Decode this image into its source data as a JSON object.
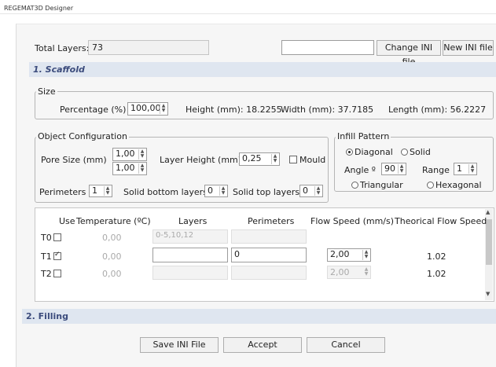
{
  "window": {
    "title": "REGEMAT3D Designer"
  },
  "top": {
    "total_layers_label": "Total Layers:",
    "total_layers_value": "73",
    "ini_path_value": "",
    "change_ini_label": "Change INI file",
    "new_ini_label": "New INI file"
  },
  "scaffold": {
    "section_title": "1. Scaffold",
    "size": {
      "group_label": "Size",
      "percentage_label": "Percentage (%)",
      "percentage_value": "100,00",
      "height_label": "Height (mm): 18.2255",
      "width_label": "Width (mm): 37.7185",
      "length_label": "Length (mm): 56.2227"
    },
    "object_config": {
      "group_label": "Object Configuration",
      "pore_size_label": "Pore Size (mm)",
      "pore_size_1": "1,00",
      "pore_size_2": "1,00",
      "layer_height_label": "Layer Height (mm)",
      "layer_height_value": "0,25",
      "mould_label": "Mould",
      "perimeters_label": "Perimeters",
      "perimeters_value": "1",
      "solid_bottom_label": "Solid bottom layers",
      "solid_bottom_value": "0",
      "solid_top_label": "Solid top layers",
      "solid_top_value": "0"
    },
    "infill": {
      "group_label": "Infill Pattern",
      "diagonal_label": "Diagonal",
      "solid_label": "Solid",
      "angle_label": "Angle º",
      "angle_value": "90",
      "range_label": "Range",
      "range_value": "1",
      "triangular_label": "Triangular",
      "hexagonal_label": "Hexagonal",
      "selected": "Diagonal"
    },
    "tools": {
      "headers": {
        "use": "Use",
        "temperature": "Temperature (ºC)",
        "layers": "Layers",
        "perimeters": "Perimeters",
        "flow_speed": "Flow Speed (mm/s)",
        "theorical_flow": "Theorical Flow Speed"
      },
      "rows": [
        {
          "name": "T0",
          "checked": false,
          "temperature": "0,00",
          "layers": "0-5,10,12",
          "perimeters": "",
          "flow_speed": "",
          "theorical": ""
        },
        {
          "name": "T1",
          "checked": true,
          "temperature": "0,00",
          "layers": "",
          "perimeters": "0",
          "flow_speed": "2,00",
          "theorical": "1.02"
        },
        {
          "name": "T2",
          "checked": false,
          "temperature": "0,00",
          "layers": "",
          "perimeters": "",
          "flow_speed": "2,00",
          "theorical": "1.02"
        }
      ]
    }
  },
  "filling": {
    "section_title": "2. Filling"
  },
  "footer": {
    "save_label": "Save INI File",
    "accept_label": "Accept",
    "cancel_label": "Cancel"
  }
}
